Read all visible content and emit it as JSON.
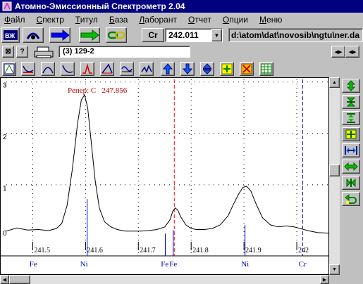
{
  "window": {
    "title": "Атомно-Эмиссионный Спектрометр 2.04"
  },
  "menu": [
    {
      "underline": "Ф",
      "rest": "айл"
    },
    {
      "underline": "С",
      "rest": "пектр"
    },
    {
      "underline": "Т",
      "rest": "итул"
    },
    {
      "underline": "Б",
      "rest": "аза"
    },
    {
      "underline": "Л",
      "rest": "аборант"
    },
    {
      "underline": "О",
      "rest": "тчет"
    },
    {
      "underline": "О",
      "rest": "пции"
    },
    {
      "underline": "М",
      "rest": "еню"
    }
  ],
  "toolbar": {
    "element": "Cr",
    "wavelength": "242.011",
    "path": "d:\\atom\\dat\\novosib\\ngtu\\ner.da"
  },
  "sample": {
    "name": "(3) 129-2"
  },
  "chart_data": {
    "type": "line",
    "annotation": "Репер: С   247.856",
    "x_ticks": [
      "241.5",
      "241.6",
      "241.7",
      "241.8",
      "241.9",
      "242"
    ],
    "y_ticks": [
      "0",
      "1",
      "2",
      "3"
    ],
    "xlim": [
      241.45,
      242.06
    ],
    "ylim": [
      0,
      3.05
    ],
    "series": [
      {
        "x": [
          241.45,
          241.47,
          241.49,
          241.51,
          241.53,
          241.545,
          241.555,
          241.565,
          241.575,
          241.585,
          241.592,
          241.598,
          241.604,
          241.61,
          241.618,
          241.626,
          241.636,
          241.648,
          241.66,
          241.675,
          241.69,
          241.705,
          241.72,
          241.735,
          241.75,
          241.76,
          241.765,
          241.77,
          241.775,
          241.78,
          241.79,
          241.8,
          241.81,
          241.825,
          241.84,
          241.855,
          241.87,
          241.88,
          241.89,
          241.898,
          241.905,
          241.913,
          241.922,
          241.935,
          241.95,
          241.965,
          241.98,
          241.995,
          242.01,
          242.025,
          242.04,
          242.06
        ],
        "y": [
          0.1,
          0.16,
          0.12,
          0.13,
          0.11,
          0.15,
          0.25,
          0.6,
          1.3,
          2.2,
          2.65,
          2.75,
          2.5,
          1.9,
          1.1,
          0.55,
          0.28,
          0.18,
          0.13,
          0.1,
          0.1,
          0.1,
          0.11,
          0.13,
          0.18,
          0.32,
          0.48,
          0.55,
          0.5,
          0.38,
          0.22,
          0.15,
          0.13,
          0.13,
          0.15,
          0.22,
          0.4,
          0.62,
          0.82,
          0.95,
          0.97,
          0.88,
          0.65,
          0.36,
          0.22,
          0.18,
          0.2,
          0.18,
          0.14,
          0.1,
          0.07,
          0.06
        ]
      }
    ],
    "markers": [
      {
        "label": "Fe",
        "x": 241.501,
        "y": 0
      },
      {
        "label": "Ni",
        "x": 241.597,
        "y": 0.55
      },
      {
        "label": "Fe",
        "x": 241.75,
        "y": 0
      },
      {
        "label": "Fe",
        "x": 241.766,
        "y": 0
      },
      {
        "label": "Ni",
        "x": 241.902,
        "y": 0.0
      },
      {
        "label": "Cr",
        "x": 242.011,
        "y": 0
      }
    ],
    "line_markers": [
      {
        "x": 241.603,
        "height": 0.72
      },
      {
        "x": 241.751,
        "height": 0.05
      },
      {
        "x": 241.766,
        "height": 0.12
      },
      {
        "x": 241.902,
        "height": 0.22
      }
    ],
    "ref_lines": [
      {
        "x": 241.768,
        "color": "#ff0000"
      },
      {
        "x": 242.011,
        "color": "#0000c0"
      }
    ],
    "colors": {
      "curve": "#000000",
      "markers": "#0000c0",
      "annotation": "#c00000",
      "grid": "#000000"
    }
  }
}
